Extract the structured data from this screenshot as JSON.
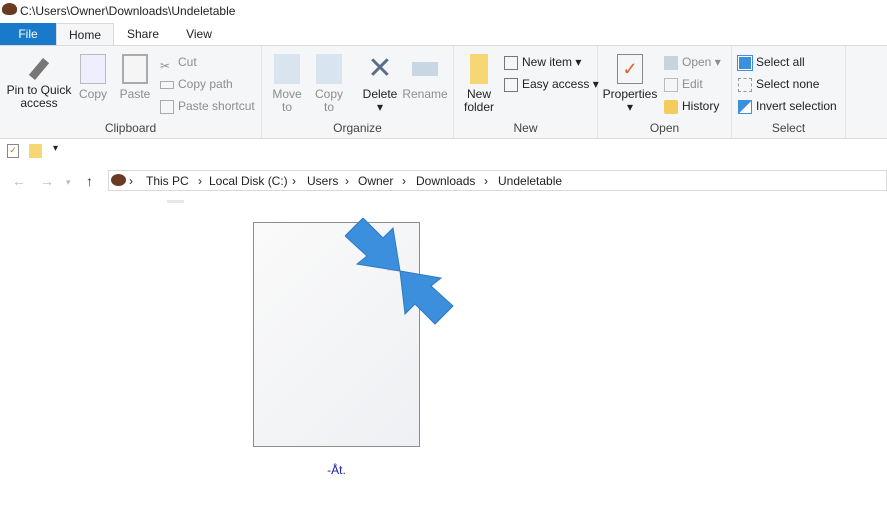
{
  "window": {
    "title": "C:\\Users\\Owner\\Downloads\\Undeletable"
  },
  "tabs": [
    "File",
    "Home",
    "Share",
    "View"
  ],
  "clipboard": {
    "pin": "Pin to Quick",
    "pin2": "access",
    "copy": "Copy",
    "paste": "Paste",
    "cut": "Cut",
    "copy_path": "Copy path",
    "paste_shortcut": "Paste shortcut",
    "label": "Clipboard"
  },
  "organize": {
    "move": "Move",
    "move2": "to",
    "copy": "Copy",
    "copy2": "to",
    "delete": "Delete",
    "rename": "Rename",
    "label": "Organize"
  },
  "new": {
    "folder": "New",
    "folder2": "folder",
    "new_item": "New item ▾",
    "easy_access": "Easy access ▾",
    "label": "New"
  },
  "open": {
    "properties": "Properties",
    "open": "Open ▾",
    "edit": "Edit",
    "history": "History",
    "label": "Open"
  },
  "select": {
    "all": "Select all",
    "none": "Select none",
    "invert": "Invert selection",
    "label": "Select"
  },
  "address": [
    "This PC",
    "Local Disk (C:)",
    "Users",
    "Owner",
    "Downloads",
    "Undeletable"
  ],
  "file": {
    "name": "-Åt."
  },
  "colors": {
    "accent": "#1979ca",
    "arrow": "#3b8fdc"
  }
}
